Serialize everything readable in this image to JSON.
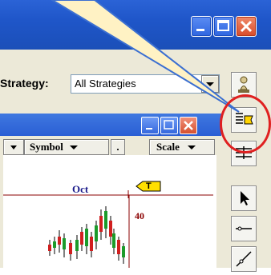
{
  "toolbar": {
    "strategy_label": "Strategy:",
    "strategy_value": "All Strategies"
  },
  "chart": {
    "symbol_label": "Symbol",
    "dot_label": ".",
    "scale_label": "Scale",
    "month_label": "Oct",
    "price_label": "40",
    "marker_label": "T"
  },
  "colors": {
    "title_blue": "#2558d4",
    "close_red": "#d64b2a",
    "highlight": "#e02020",
    "callout_fill": "#fff2c4",
    "up_candle": "#1b9b2a",
    "down_candle": "#d11f1f",
    "axis": "#8b0000"
  },
  "icons": [
    "minimize-icon",
    "maximize-icon",
    "close-icon",
    "dropdown-arrow-icon",
    "chess-pawn-icon",
    "grid-flag-icon",
    "grid-icon",
    "cursor-arrow-icon",
    "horizontal-line-icon",
    "diagonal-line-icon"
  ]
}
